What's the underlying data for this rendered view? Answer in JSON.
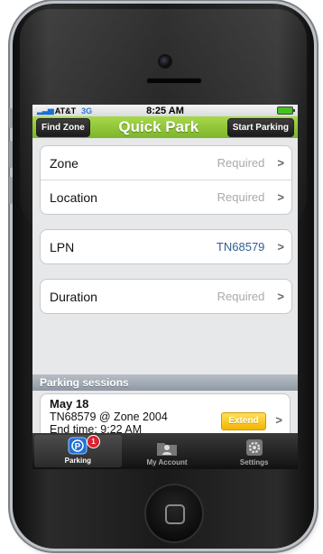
{
  "status_bar": {
    "carrier": "AT&T",
    "network": "3G",
    "time": "8:25 AM"
  },
  "nav": {
    "left_button": "Find Zone",
    "title": "Quick Park",
    "right_button": "Start Parking"
  },
  "form": {
    "zone": {
      "label": "Zone",
      "value": "Required"
    },
    "location": {
      "label": "Location",
      "value": "Required"
    },
    "lpn": {
      "label": "LPN",
      "value": "TN68579"
    },
    "duration": {
      "label": "Duration",
      "value": "Required"
    }
  },
  "sessions": {
    "header": "Parking sessions",
    "items": [
      {
        "date": "May 18",
        "detail": "TN68579 @ Zone 2004",
        "end_time": "End time: 9:22 AM",
        "action": "Extend"
      }
    ]
  },
  "tabs": [
    {
      "label": "Parking",
      "badge": "1",
      "icon": "parking-icon"
    },
    {
      "label": "My Account",
      "icon": "account-icon"
    },
    {
      "label": "Settings",
      "icon": "settings-icon"
    }
  ],
  "colors": {
    "nav_green": "#8cc63f",
    "lpn_blue": "#2f5e93",
    "extend_yellow": "#f4b400",
    "badge_red": "#d9232d"
  }
}
